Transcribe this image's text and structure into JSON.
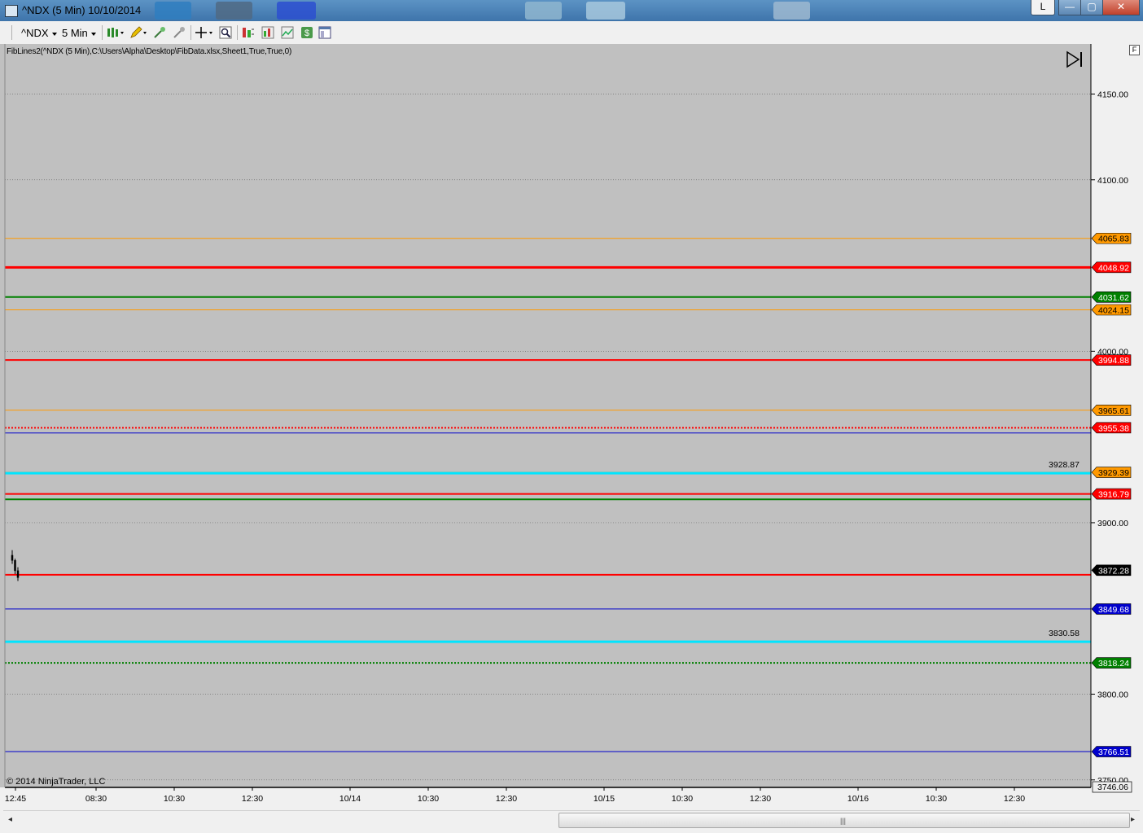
{
  "window": {
    "title": "^NDX (5 Min)  10/10/2014",
    "buttons": {
      "l": "L",
      "min": "—",
      "max": "▢",
      "close": "✕"
    }
  },
  "toolbar": {
    "instrument": "^NDX",
    "interval": "5 Min",
    "icons": [
      "chart-style-icon",
      "drawing-pencil-icon",
      "add-indicator-icon",
      "strategy-icon",
      "crosshair-icon",
      "zoom-icon",
      "data-series-icon",
      "bar-chart-icon",
      "line-chart-icon",
      "dollar-icon",
      "properties-icon"
    ]
  },
  "chart": {
    "indicator_label": "FibLines2(^NDX (5 Min),C:\\Users\\Alpha\\Desktop\\FibData.xlsx,Sheet1,True,True,0)",
    "copyright": "© 2014 NinjaTrader, LLC",
    "f_button": "F",
    "colors": {
      "background": "#c0c0c0",
      "orange": "#ff9900",
      "red": "#ff0000",
      "green": "#008000",
      "cyan": "#00e5ff",
      "blue": "#0000cc",
      "black": "#000000"
    }
  },
  "chart_data": {
    "type": "line",
    "y_axis": {
      "ticks": [
        "4150.00",
        "4100.00",
        "4000.00",
        "3900.00",
        "3800.00",
        "3750.00"
      ],
      "ylim": [
        3746.06,
        4170
      ]
    },
    "x_axis": {
      "labels": [
        "12:45",
        "08:30",
        "10:30",
        "12:30",
        "10/14",
        "10:30",
        "12:30",
        "10/15",
        "10:30",
        "12:30",
        "10/16",
        "10:30",
        "12:30"
      ]
    },
    "price_levels": [
      {
        "value": 4065.83,
        "label": "4065.83",
        "color": "orange",
        "style": "solid",
        "width": 1
      },
      {
        "value": 4048.92,
        "label": "4048.92",
        "color": "red",
        "style": "solid",
        "width": 3
      },
      {
        "value": 4031.62,
        "label": "4031.62",
        "color": "green",
        "style": "solid",
        "width": 2
      },
      {
        "value": 4024.15,
        "label": "4024.15",
        "color": "orange",
        "style": "solid",
        "width": 1
      },
      {
        "value": 3994.88,
        "label": "3994.88",
        "color": "red",
        "style": "solid",
        "width": 2
      },
      {
        "value": 3965.61,
        "label": "3965.61",
        "color": "orange",
        "style": "solid",
        "width": 1
      },
      {
        "value": 3955.38,
        "label": "3955.38",
        "color": "red",
        "style": "dotted",
        "width": 2
      },
      {
        "value": 3952.3,
        "label": "",
        "color": "blue",
        "style": "solid",
        "width": 1
      },
      {
        "value": 3929.39,
        "label": "3929.39",
        "color": "orange",
        "style": "solid",
        "width": 1
      },
      {
        "value": 3928.87,
        "label": "3928.87",
        "color": "cyan",
        "style": "solid",
        "width": 3,
        "inline": true
      },
      {
        "value": 3916.79,
        "label": "3916.79",
        "color": "red",
        "style": "solid",
        "width": 2
      },
      {
        "value": 3913.61,
        "label": "",
        "color": "green",
        "style": "solid",
        "width": 2
      },
      {
        "value": 3872.28,
        "label": "3872.28",
        "color": "black",
        "style": "none",
        "width": 0
      },
      {
        "value": 3869.64,
        "label": "",
        "color": "red",
        "style": "solid",
        "width": 2
      },
      {
        "value": 3849.68,
        "label": "3849.68",
        "color": "blue",
        "style": "solid",
        "width": 1
      },
      {
        "value": 3830.58,
        "label": "3830.58",
        "color": "cyan",
        "style": "solid",
        "width": 3,
        "inline": true
      },
      {
        "value": 3818.24,
        "label": "3818.24",
        "color": "green",
        "style": "dotted",
        "width": 2
      },
      {
        "value": 3766.51,
        "label": "3766.51",
        "color": "blue",
        "style": "solid",
        "width": 1
      }
    ],
    "last_price": {
      "value": 3746.06,
      "label": "3746.06"
    },
    "candles": [
      {
        "open": 3881,
        "high": 3884,
        "low": 3876,
        "close": 3878
      },
      {
        "open": 3878,
        "high": 3879,
        "low": 3870,
        "close": 3872
      },
      {
        "open": 3872,
        "high": 3874,
        "low": 3866,
        "close": 3868
      }
    ],
    "grid": true
  }
}
